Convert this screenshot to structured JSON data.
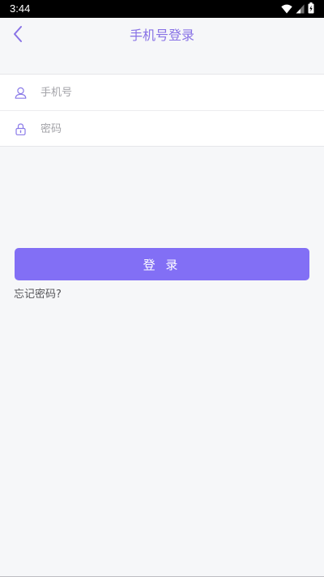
{
  "status_bar": {
    "time": "3:44",
    "icons": [
      "wifi-icon",
      "signal-icon",
      "battery-icon"
    ]
  },
  "header": {
    "title": "手机号登录",
    "back_icon": "chevron-left-icon"
  },
  "form": {
    "phone": {
      "icon": "user-icon",
      "placeholder": "手机号",
      "value": ""
    },
    "password": {
      "icon": "lock-icon",
      "placeholder": "密码",
      "value": ""
    }
  },
  "login_button": {
    "label": "登 录"
  },
  "forgot_password": {
    "label": "忘记密码?"
  },
  "colors": {
    "accent": "#826ff5",
    "title": "#8872e6",
    "background": "#f6f7f9",
    "card": "#ffffff"
  }
}
